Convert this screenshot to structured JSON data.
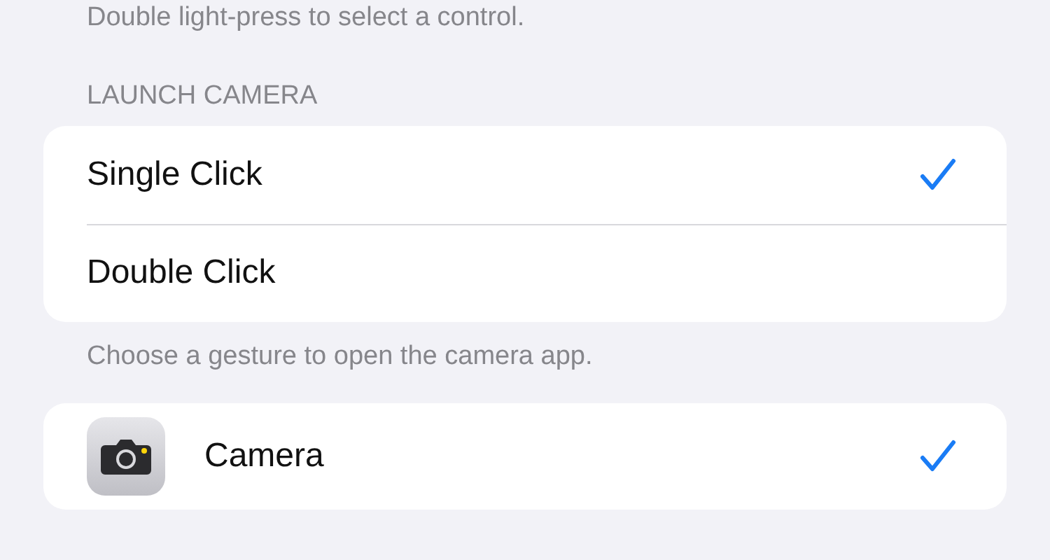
{
  "top_footer": "Double light-press to select a control.",
  "launch_camera": {
    "heading": "LAUNCH CAMERA",
    "options": [
      {
        "label": "Single Click",
        "selected": true
      },
      {
        "label": "Double Click",
        "selected": false
      }
    ],
    "footer": "Choose a gesture to open the camera app."
  },
  "apps": [
    {
      "label": "Camera",
      "selected": true
    }
  ]
}
